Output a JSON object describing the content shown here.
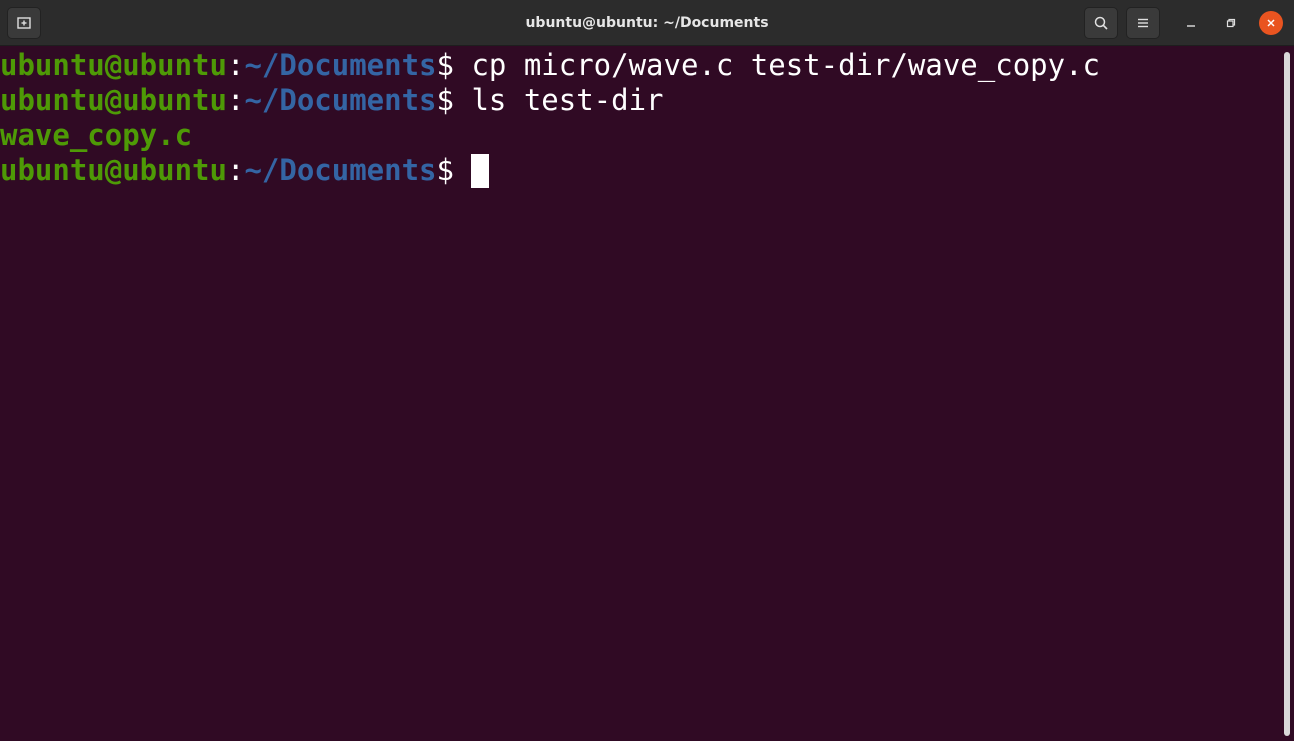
{
  "window": {
    "title": "ubuntu@ubuntu: ~/Documents"
  },
  "colors": {
    "background": "#300a24",
    "prompt_user": "#4e9a06",
    "prompt_path": "#3465a4",
    "text": "#ffffff",
    "close_button": "#e95420"
  },
  "icons": {
    "new_tab": "new-tab-icon",
    "search": "search-icon",
    "menu": "hamburger-menu-icon",
    "minimize": "minimize-icon",
    "maximize": "maximize-icon",
    "close": "close-icon"
  },
  "terminal": {
    "lines": [
      {
        "user": "ubuntu@ubuntu",
        "colon": ":",
        "path": "~/Documents",
        "symbol": "$",
        "command": " cp micro/wave.c test-dir/wave_copy.c"
      },
      {
        "user": "ubuntu@ubuntu",
        "colon": ":",
        "path": "~/Documents",
        "symbol": "$",
        "command": " ls test-dir"
      },
      {
        "output": "wave_copy.c"
      },
      {
        "user": "ubuntu@ubuntu",
        "colon": ":",
        "path": "~/Documents",
        "symbol": "$",
        "command": " "
      }
    ]
  }
}
